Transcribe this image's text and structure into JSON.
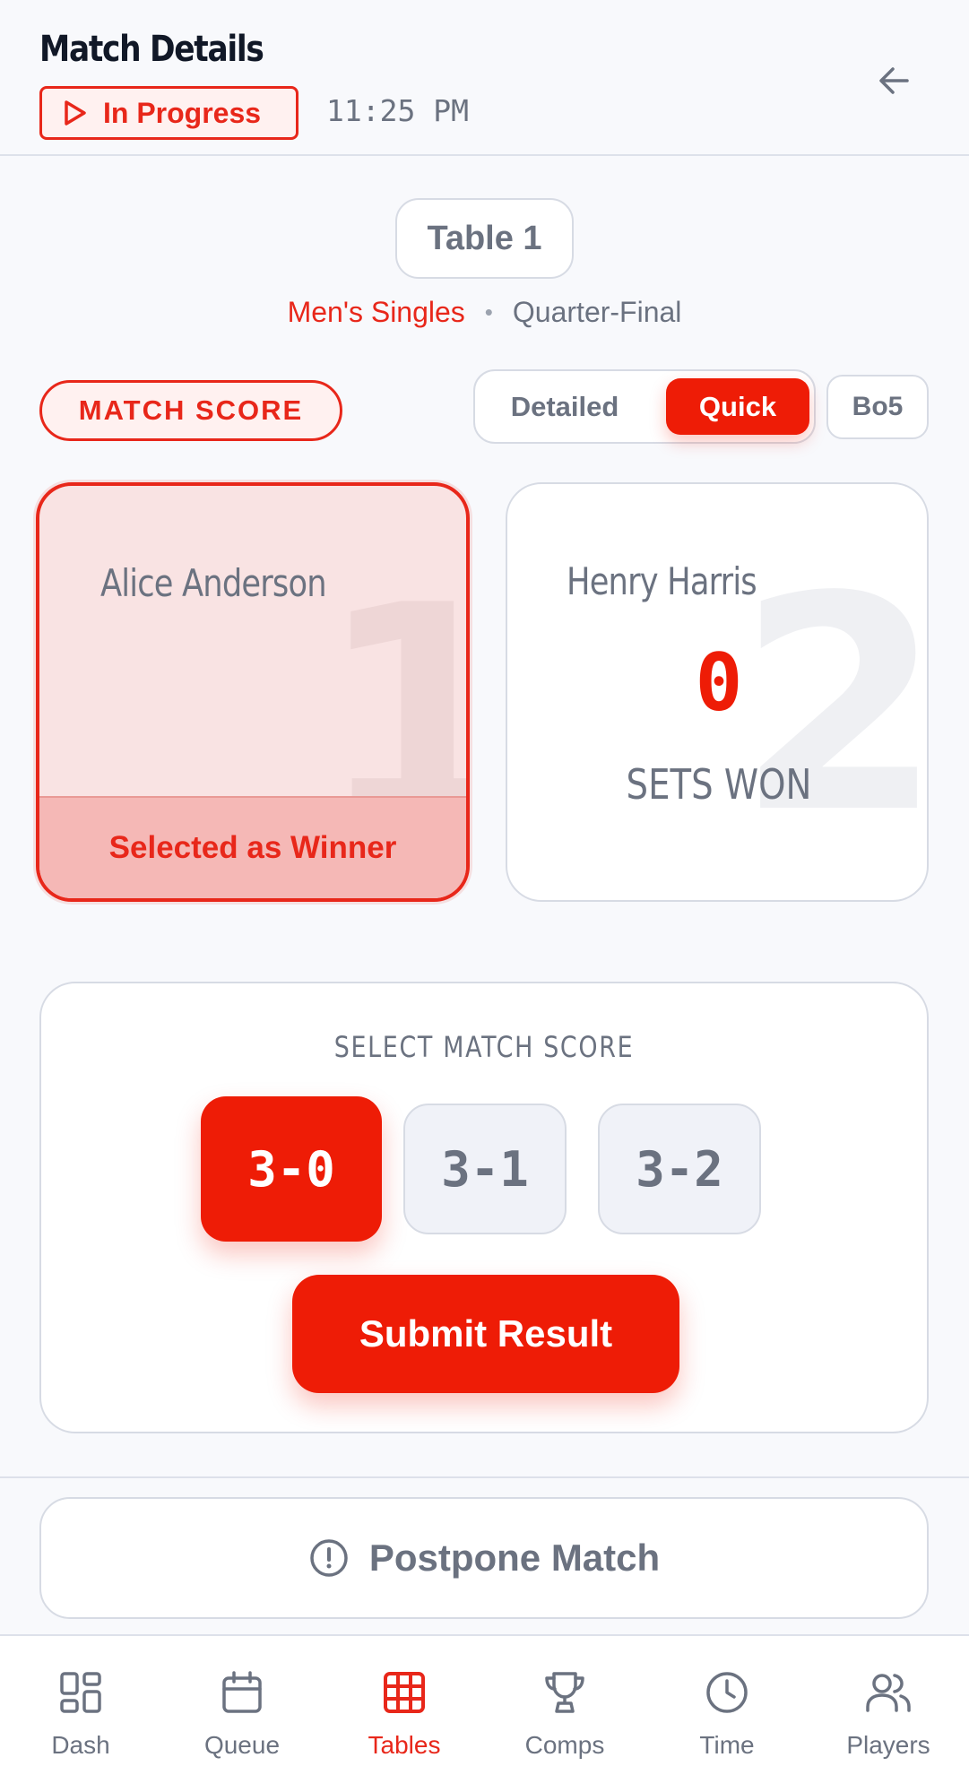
{
  "header": {
    "title": "Match Details",
    "status": "In Progress",
    "time": "11:25 PM"
  },
  "match": {
    "table": "Table 1",
    "event": "Men's Singles",
    "separator": "•",
    "round": "Quarter-Final"
  },
  "score_section": {
    "label": "MATCH SCORE",
    "mode_options": [
      "Detailed",
      "Quick"
    ],
    "selected_mode": "Quick",
    "format": "Bo5"
  },
  "players": [
    {
      "seed": "1",
      "name": "Alice Anderson",
      "winner_label": "Selected as Winner",
      "selected": true
    },
    {
      "seed": "2",
      "name": "Henry Harris",
      "sets_won": "0",
      "sets_label": "SETS WON",
      "selected": false
    }
  ],
  "score_select": {
    "heading": "SELECT MATCH SCORE",
    "options": [
      "3-0",
      "3-1",
      "3-2"
    ],
    "selected": "3-0",
    "submit_label": "Submit Result"
  },
  "postpone_label": "Postpone Match",
  "nav": {
    "items": [
      {
        "label": "Dash",
        "icon": "dashboard-icon"
      },
      {
        "label": "Queue",
        "icon": "calendar-icon"
      },
      {
        "label": "Tables",
        "icon": "grid-icon"
      },
      {
        "label": "Comps",
        "icon": "trophy-icon"
      },
      {
        "label": "Time",
        "icon": "clock-icon"
      },
      {
        "label": "Players",
        "icon": "users-icon"
      }
    ],
    "active": "Tables"
  },
  "colors": {
    "accent": "#ee1c06",
    "muted_text": "#6b7280",
    "border": "#d7dbe4",
    "background": "#f8f9fc"
  }
}
